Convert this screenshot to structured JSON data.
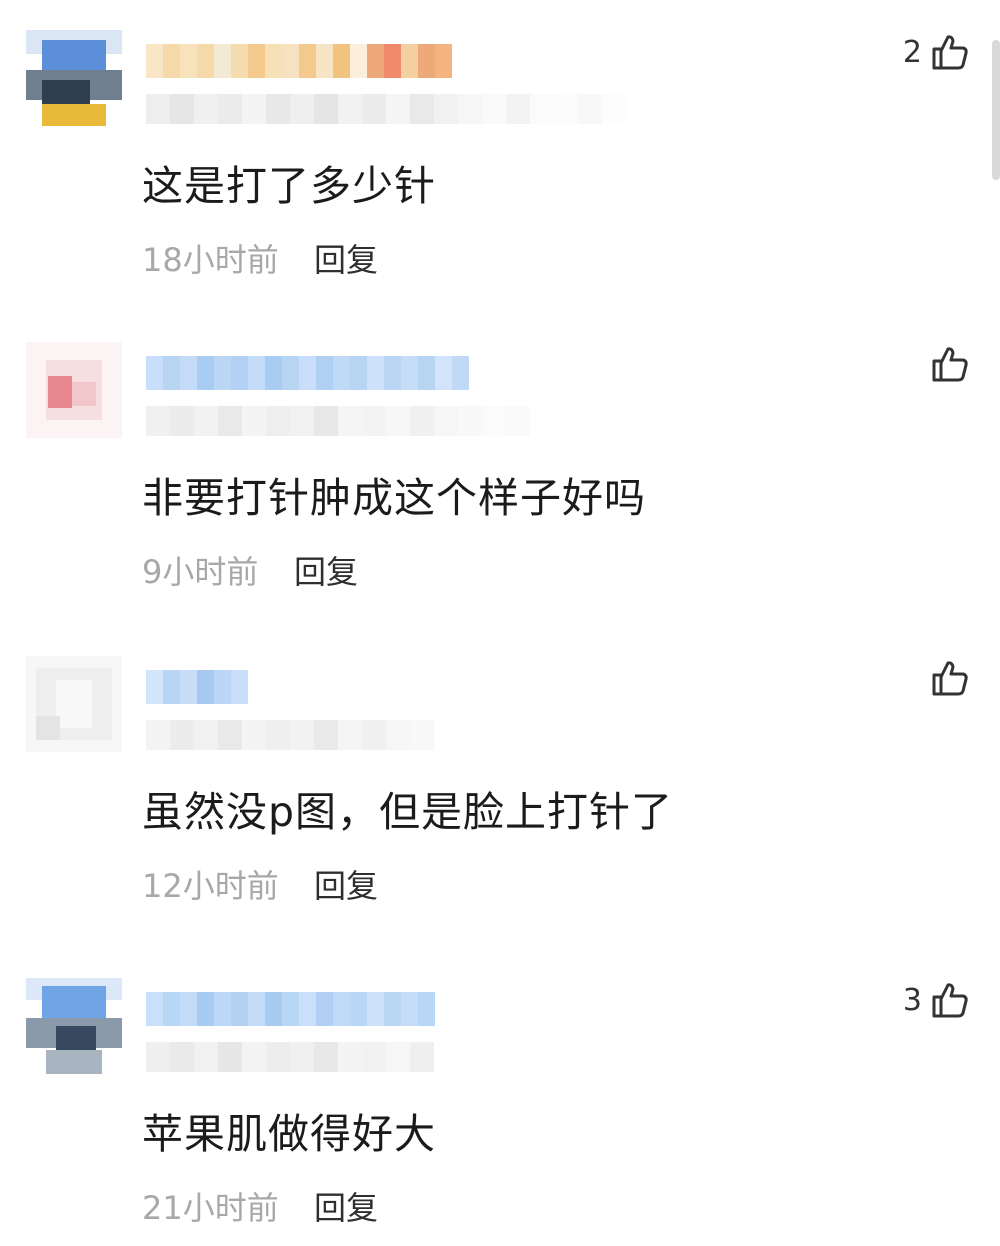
{
  "comments": [
    {
      "text": "这是打了多少针",
      "time": "18小时前",
      "reply_label": "回复",
      "like_count": "2",
      "avatar_colors": [
        "#5b8fd8",
        "#2f3e4e",
        "#e9b93a"
      ],
      "name_colors": [
        "#f6d9a8",
        "#f3c98d",
        "#eea97a",
        "#f08a6a"
      ]
    },
    {
      "text": "非要打针肿成这个样子好吗",
      "time": "9小时前",
      "reply_label": "回复",
      "like_count": "",
      "avatar_colors": [
        "#f2c7cb",
        "#e9878f",
        "#f5dfe1"
      ],
      "name_colors": [
        "#b7d4f3",
        "#a9ccf2"
      ]
    },
    {
      "text": "虽然没p图，但是脸上打针了",
      "time": "12小时前",
      "reply_label": "回复",
      "like_count": "",
      "avatar_colors": [
        "#f0f0f0",
        "#e4e4e4",
        "#f7f7f7"
      ],
      "name_colors": [
        "#b9d5f4",
        "#a7c8ef"
      ]
    },
    {
      "text": "苹果肌做得好大",
      "time": "21小时前",
      "reply_label": "回复",
      "like_count": "3",
      "avatar_colors": [
        "#6fa5e6",
        "#36495e",
        "#a8b4c0"
      ],
      "name_colors": [
        "#b8d6f5",
        "#a8cbf1"
      ]
    }
  ]
}
